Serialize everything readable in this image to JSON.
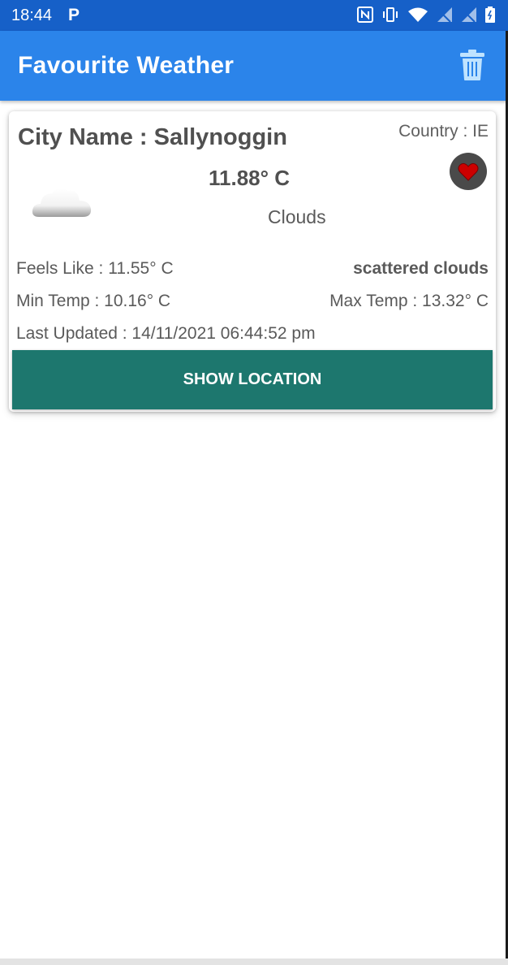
{
  "status_bar": {
    "time": "18:44",
    "notification": "P",
    "icons": [
      "nfc-icon",
      "vibrate-icon",
      "wifi-icon",
      "signal-icon",
      "signal-icon",
      "battery-icon"
    ]
  },
  "app_bar": {
    "title": "Favourite Weather",
    "background": "#2b84ea"
  },
  "card": {
    "city_name": "City Name : Sallynoggin",
    "country": "Country : IE",
    "temperature": "11.88° C",
    "condition": "Clouds",
    "feels_like": "Feels Like : 11.55° C",
    "description": "scattered clouds",
    "min_temp": "Min Temp : 10.16° C",
    "max_temp": "Max Temp : 13.32° C",
    "last_updated": "Last Updated : 14/11/2021 06:44:52 pm",
    "show_location_label": "SHOW LOCATION",
    "button_color": "#1d776e",
    "favourite_color": "#cc0000"
  }
}
